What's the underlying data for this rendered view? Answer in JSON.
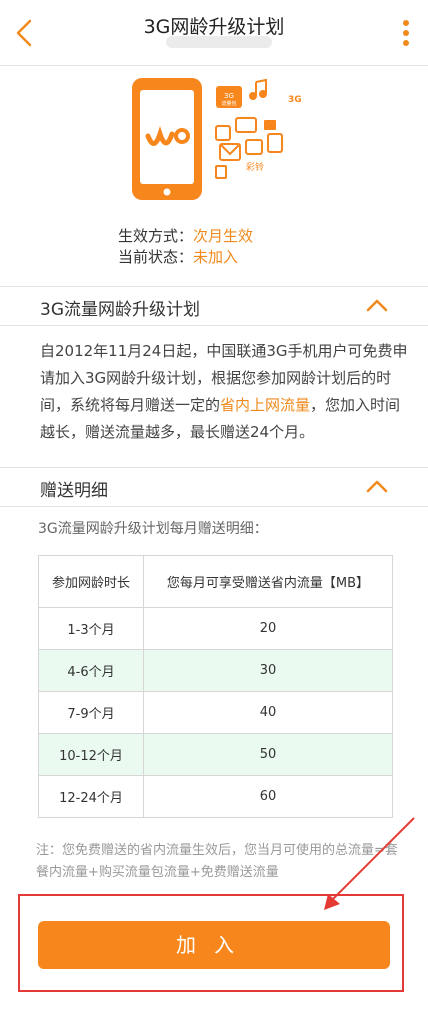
{
  "header": {
    "title": "3G网龄升级计划",
    "back_icon": "chevron-left-icon",
    "more_icon": "more-vertical-icon",
    "accent": "#f08a1c"
  },
  "hero": {
    "phone_icon": "phone-wo-icon",
    "badge_3g": "3G",
    "badge_chat": "3G",
    "badge_chat_sub": "流量包",
    "badge_color": "彩铃",
    "logo_text": "沃"
  },
  "status": {
    "effect_label": "生效方式：",
    "effect_value": "次月生效",
    "state_label": "当前状态：",
    "state_value": "未加入"
  },
  "section_plan": {
    "title": "3G流量网龄升级计划",
    "desc_before": "自2012年11月24日起，中国联通3G手机用户可免费申请加入3G网龄升级计划，根据您参加网龄计划后的时间，系统将每月赠送一定的",
    "desc_highlight": "省内上网流量",
    "desc_after": "，您加入时间越长，赠送流量越多，最长赠送24个月。"
  },
  "section_detail": {
    "title": "赠送明细",
    "caption": "3G流量网龄升级计划每月赠送明细：",
    "columns": [
      "参加网龄时长",
      "您每月可享受赠送省内流量【MB】"
    ],
    "rows": [
      [
        "1-3个月",
        "20"
      ],
      [
        "4-6个月",
        "30"
      ],
      [
        "7-9个月",
        "40"
      ],
      [
        "10-12个月",
        "50"
      ],
      [
        "12-24个月",
        "60"
      ]
    ]
  },
  "note": "注：您免费赠送的省内流量生效后，您当月可使用的总流量=套餐内流量+购买流量包流量+免费赠送流量",
  "join_button": {
    "label": "加入",
    "color": "#f7871d"
  },
  "annotation": {
    "box_color": "#e53935"
  }
}
